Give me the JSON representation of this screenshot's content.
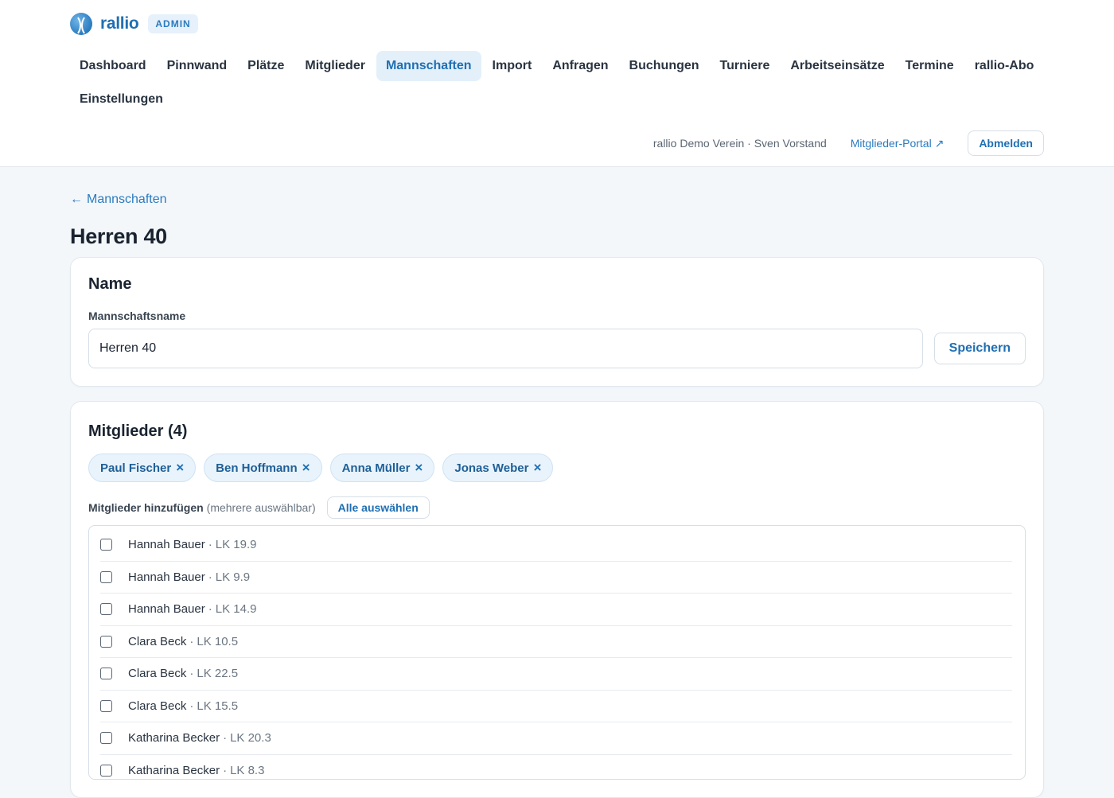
{
  "brand": {
    "name": "rallio",
    "badge": "ADMIN"
  },
  "nav": [
    {
      "label": "Dashboard",
      "active": false
    },
    {
      "label": "Pinnwand",
      "active": false
    },
    {
      "label": "Plätze",
      "active": false
    },
    {
      "label": "Mitglieder",
      "active": false
    },
    {
      "label": "Mannschaften",
      "active": true
    },
    {
      "label": "Import",
      "active": false
    },
    {
      "label": "Anfragen",
      "active": false
    },
    {
      "label": "Buchungen",
      "active": false
    },
    {
      "label": "Turniere",
      "active": false
    },
    {
      "label": "Arbeitseinsätze",
      "active": false
    },
    {
      "label": "Termine",
      "active": false
    },
    {
      "label": "rallio-Abo",
      "active": false
    },
    {
      "label": "Einstellungen",
      "active": false
    }
  ],
  "userbar": {
    "org_info": "rallio Demo Verein · Sven Vorstand",
    "portal_label": "Mitglieder-Portal ↗",
    "logout_label": "Abmelden"
  },
  "back": {
    "arrow": "←",
    "label": "Mannschaften"
  },
  "page_title": "Herren 40",
  "name_card": {
    "heading": "Name",
    "field_label": "Mannschaftsname",
    "value": "Herren 40",
    "save_label": "Speichern"
  },
  "members_card": {
    "heading": "Mitglieder (4)",
    "chips": [
      "Paul Fischer",
      "Ben Hoffmann",
      "Anna Müller",
      "Jonas Weber"
    ],
    "remove_glyph": "×",
    "add_label": "Mitglieder hinzufügen",
    "add_hint": "(mehrere auswählbar)",
    "select_all_label": "Alle auswählen",
    "separator": "·",
    "candidates": [
      {
        "name": "Hannah Bauer",
        "lk": "LK 19.9"
      },
      {
        "name": "Hannah Bauer",
        "lk": "LK 9.9"
      },
      {
        "name": "Hannah Bauer",
        "lk": "LK 14.9"
      },
      {
        "name": "Clara Beck",
        "lk": "LK 10.5"
      },
      {
        "name": "Clara Beck",
        "lk": "LK 22.5"
      },
      {
        "name": "Clara Beck",
        "lk": "LK 15.5"
      },
      {
        "name": "Katharina Becker",
        "lk": "LK 20.3"
      },
      {
        "name": "Katharina Becker",
        "lk": "LK 8.3"
      }
    ]
  },
  "colors": {
    "accent": "#1f6fb2",
    "background": "#f3f7fa",
    "chip_bg": "#e8f3fc"
  },
  "icons": {
    "logo": "tennis-ball-icon",
    "back": "arrow-left-icon",
    "external": "external-link-icon",
    "remove": "close-icon"
  }
}
